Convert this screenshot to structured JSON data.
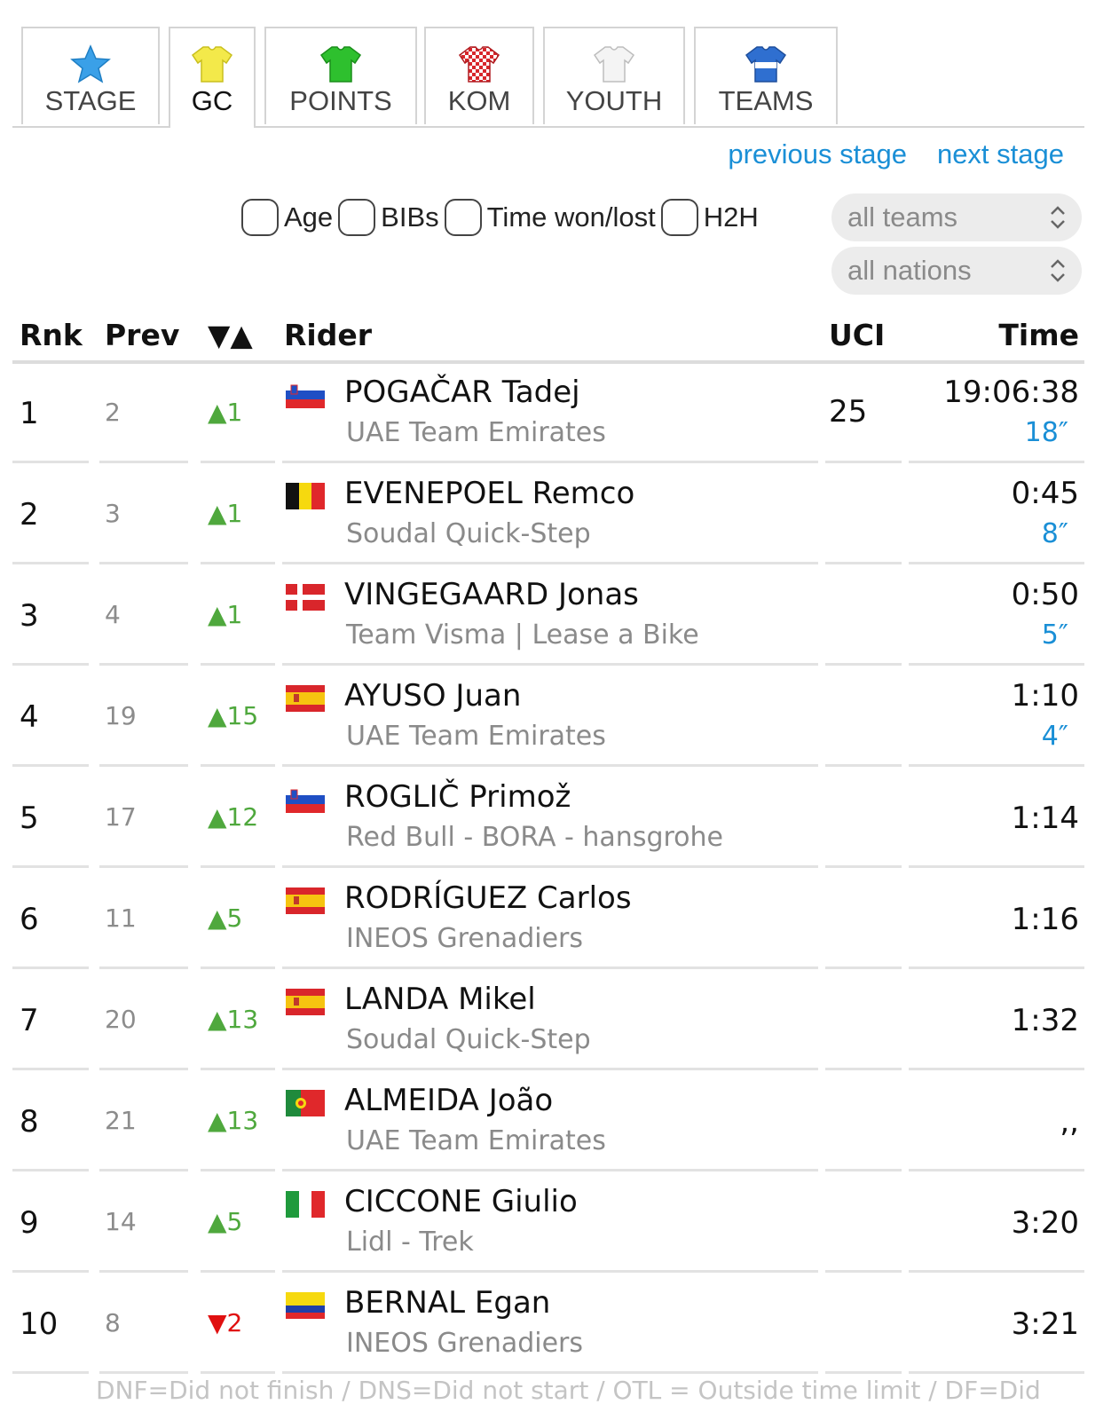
{
  "tabs": [
    {
      "label": "STAGE",
      "icon": "star-icon",
      "color": "#3aa0e8"
    },
    {
      "label": "GC",
      "icon": "yellow-jersey-icon",
      "color": "#f3e94a",
      "active": true
    },
    {
      "label": "POINTS",
      "icon": "green-jersey-icon",
      "color": "#2ec02e"
    },
    {
      "label": "KOM",
      "icon": "polka-dot-jersey-icon",
      "color": "#d8262b"
    },
    {
      "label": "YOUTH",
      "icon": "white-jersey-icon",
      "color": "#f4f4f4"
    },
    {
      "label": "TEAMS",
      "icon": "team-jersey-icon",
      "color": "#2f6fd0"
    }
  ],
  "nav": {
    "previous": "previous stage",
    "next": "next stage"
  },
  "filters": {
    "options": [
      "Age",
      "BIBs",
      "Time won/lost",
      "H2H"
    ],
    "teams_select": "all teams",
    "nations_select": "all nations"
  },
  "table": {
    "headers": {
      "rnk": "Rnk",
      "prev": "Prev",
      "move": "▼▲",
      "rider": "Rider",
      "uci": "UCI",
      "time": "Time"
    },
    "rows": [
      {
        "rnk": "1",
        "prev": "2",
        "move": "▲1",
        "dir": "up",
        "flag": "SI",
        "rider": "POGAČAR Tadej",
        "team": "UAE Team Emirates",
        "uci": "25",
        "time": "19:06:38",
        "bonus": "18″"
      },
      {
        "rnk": "2",
        "prev": "3",
        "move": "▲1",
        "dir": "up",
        "flag": "BE",
        "rider": "EVENEPOEL Remco",
        "team": "Soudal Quick-Step",
        "uci": "",
        "time": "0:45",
        "bonus": "8″"
      },
      {
        "rnk": "3",
        "prev": "4",
        "move": "▲1",
        "dir": "up",
        "flag": "DK",
        "rider": "VINGEGAARD Jonas",
        "team": "Team Visma | Lease a Bike",
        "uci": "",
        "time": "0:50",
        "bonus": "5″"
      },
      {
        "rnk": "4",
        "prev": "19",
        "move": "▲15",
        "dir": "up",
        "flag": "ES",
        "rider": "AYUSO Juan",
        "team": "UAE Team Emirates",
        "uci": "",
        "time": "1:10",
        "bonus": "4″"
      },
      {
        "rnk": "5",
        "prev": "17",
        "move": "▲12",
        "dir": "up",
        "flag": "SI",
        "rider": "ROGLIČ Primož",
        "team": "Red Bull - BORA - hansgrohe",
        "uci": "",
        "time": "1:14",
        "bonus": ""
      },
      {
        "rnk": "6",
        "prev": "11",
        "move": "▲5",
        "dir": "up",
        "flag": "ES",
        "rider": "RODRÍGUEZ Carlos",
        "team": "INEOS Grenadiers",
        "uci": "",
        "time": "1:16",
        "bonus": ""
      },
      {
        "rnk": "7",
        "prev": "20",
        "move": "▲13",
        "dir": "up",
        "flag": "ES",
        "rider": "LANDA Mikel",
        "team": "Soudal Quick-Step",
        "uci": "",
        "time": "1:32",
        "bonus": ""
      },
      {
        "rnk": "8",
        "prev": "21",
        "move": "▲13",
        "dir": "up",
        "flag": "PT",
        "rider": "ALMEIDA João",
        "team": "UAE Team Emirates",
        "uci": "",
        "time": ",,",
        "bonus": ""
      },
      {
        "rnk": "9",
        "prev": "14",
        "move": "▲5",
        "dir": "up",
        "flag": "IT",
        "rider": "CICCONE Giulio",
        "team": "Lidl - Trek",
        "uci": "",
        "time": "3:20",
        "bonus": ""
      },
      {
        "rnk": "10",
        "prev": "8",
        "move": "▼2",
        "dir": "down",
        "flag": "CO",
        "rider": "BERNAL Egan",
        "team": "INEOS Grenadiers",
        "uci": "",
        "time": "3:21",
        "bonus": ""
      }
    ]
  },
  "footnote": "DNF=Did not finish / DNS=Did not start / OTL = Outside time limit / DF=Did"
}
